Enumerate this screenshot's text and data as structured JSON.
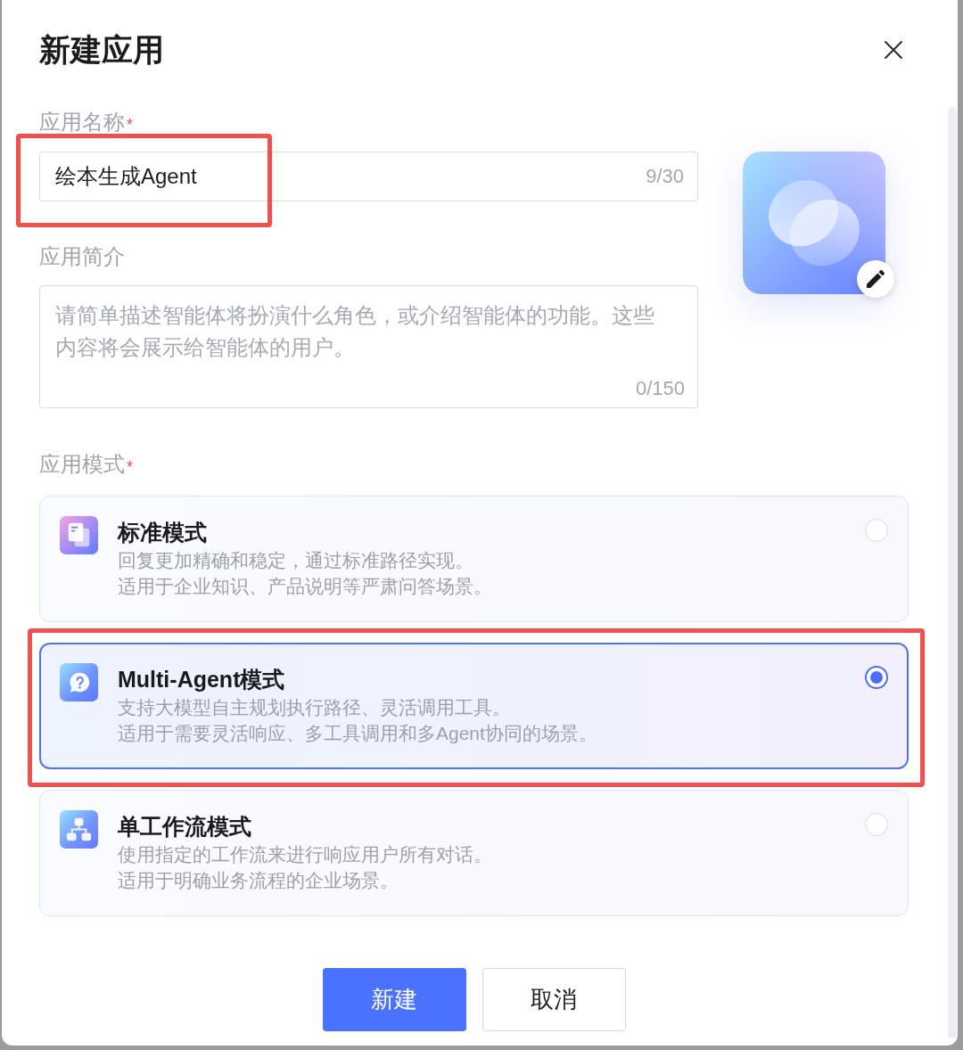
{
  "dialog": {
    "title": "新建应用"
  },
  "name_field": {
    "label": "应用名称",
    "required_mark": "*",
    "value": "绘本生成Agent",
    "counter": "9/30",
    "highlighted": true
  },
  "description_field": {
    "label": "应用简介",
    "placeholder": "请简单描述智能体将扮演什么角色，或介绍智能体的功能。这些内容将会展示给智能体的用户。",
    "counter": "0/150"
  },
  "mode_field": {
    "label": "应用模式",
    "required_mark": "*",
    "options": [
      {
        "title": "标准模式",
        "lines": [
          "回复更加精确和稳定，通过标准路径实现。",
          "适用于企业知识、产品说明等严肃问答场景。"
        ],
        "selected": false,
        "highlighted": false
      },
      {
        "title": "Multi-Agent模式",
        "lines": [
          "支持大模型自主规划执行路径、灵活调用工具。",
          "适用于需要灵活响应、多工具调用和多Agent协同的场景。"
        ],
        "selected": true,
        "highlighted": true
      },
      {
        "title": "单工作流模式",
        "lines": [
          "使用指定的工作流来进行响应用户所有对话。",
          "适用于明确业务流程的企业场景。"
        ],
        "selected": false,
        "highlighted": false
      }
    ]
  },
  "buttons": [
    {
      "label": "新建",
      "kind": "primary"
    },
    {
      "label": "取消",
      "kind": "secondary"
    }
  ]
}
